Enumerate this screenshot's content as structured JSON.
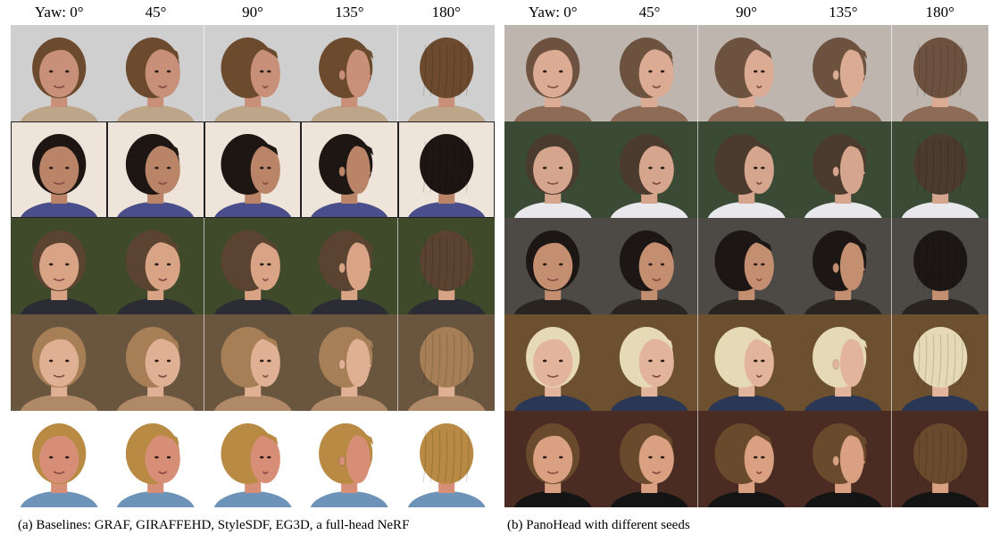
{
  "left_panel": {
    "headers": [
      "Yaw: 0°",
      "45°",
      "90°",
      "135°",
      "180°"
    ],
    "caption": "(a) Baselines: GRAF, GIRAFFEHD, StyleSDF, EG3D, a full-head NeRF",
    "rows": [
      {
        "bg": "#cfcfcf",
        "hair": "#6b4a2e",
        "skin": "#c99079",
        "cloth": "#bda58a"
      },
      {
        "bg": "#eee4da",
        "hair": "#1d1613",
        "skin": "#b98467",
        "cloth": "#4a4e8a"
      },
      {
        "bg": "#3f4a2b",
        "hair": "#5a4330",
        "skin": "#d9a486",
        "cloth": "#2c2c34"
      },
      {
        "bg": "#6a553f",
        "hair": "#a67f56",
        "skin": "#e0b095",
        "cloth": "#b08a68"
      },
      {
        "bg": "#ffffff",
        "hair": "#b88a44",
        "skin": "#d68f76",
        "cloth": "#6d93b8"
      }
    ]
  },
  "right_panel": {
    "headers": [
      "Yaw: 0°",
      "45°",
      "90°",
      "135°",
      "180°"
    ],
    "caption": "(b) PanoHead with different seeds",
    "rows": [
      {
        "bg": "#bdb5ae",
        "hair": "#6e5240",
        "skin": "#dcab93",
        "cloth": "#8d6b57"
      },
      {
        "bg": "#3a4a34",
        "hair": "#4b3a2e",
        "skin": "#d6a58d",
        "cloth": "#e8e8ec"
      },
      {
        "bg": "#4d4a46",
        "hair": "#1c1714",
        "skin": "#c48e70",
        "cloth": "#2a2420"
      },
      {
        "bg": "#6d5030",
        "hair": "#e6d9b5",
        "skin": "#e2b49c",
        "cloth": "#2b3855"
      },
      {
        "bg": "#4a2c22",
        "hair": "#6a4a2c",
        "skin": "#d9a082",
        "cloth": "#141414"
      }
    ]
  }
}
